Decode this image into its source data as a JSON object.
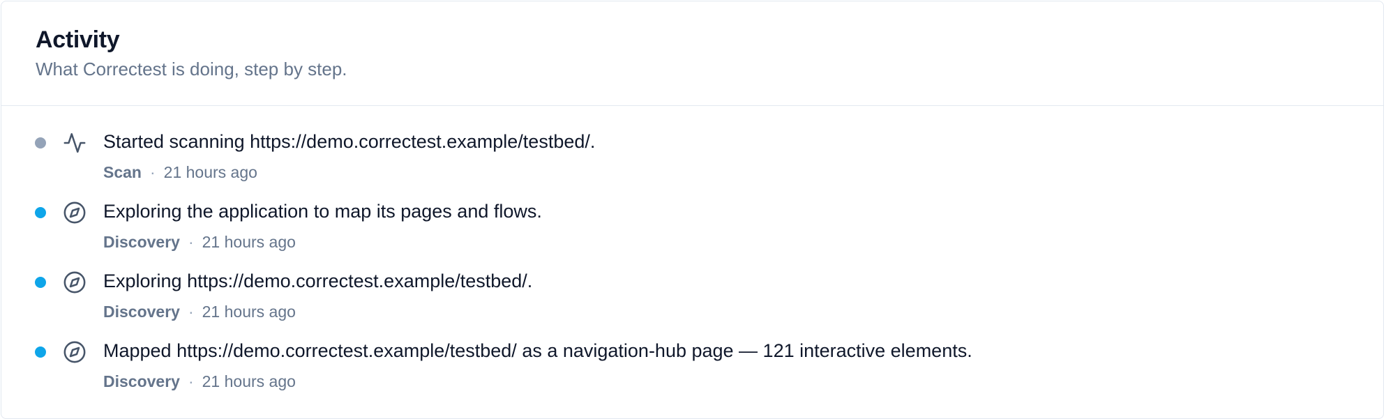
{
  "header": {
    "title": "Activity",
    "subtitle": "What Correctest is doing, step by step."
  },
  "colors": {
    "dot_scan": "#94a3b8",
    "dot_discovery": "#0ea5e9",
    "icon": "#475569"
  },
  "separator": "·",
  "events": [
    {
      "icon": "activity-icon",
      "status": "scan",
      "message": "Started scanning https://demo.correctest.example/testbed/.",
      "category": "Scan",
      "time": "21 hours ago"
    },
    {
      "icon": "compass-icon",
      "status": "discovery",
      "message": "Exploring the application to map its pages and flows.",
      "category": "Discovery",
      "time": "21 hours ago"
    },
    {
      "icon": "compass-icon",
      "status": "discovery",
      "message": "Exploring https://demo.correctest.example/testbed/.",
      "category": "Discovery",
      "time": "21 hours ago"
    },
    {
      "icon": "compass-icon",
      "status": "discovery",
      "message": "Mapped https://demo.correctest.example/testbed/ as a navigation-hub page — 121 interactive elements.",
      "category": "Discovery",
      "time": "21 hours ago"
    }
  ]
}
